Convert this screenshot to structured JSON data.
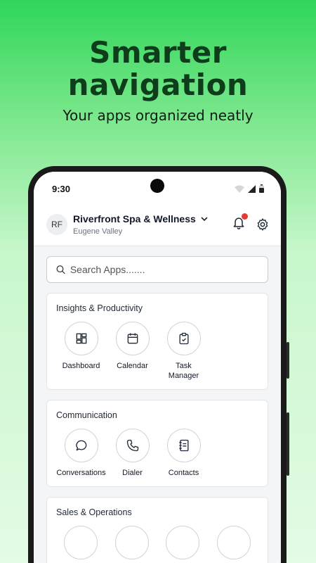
{
  "promo": {
    "title_line1": "Smarter",
    "title_line2": "navigation",
    "subtitle": "Your apps organized neatly"
  },
  "status_bar": {
    "time": "9:30"
  },
  "header": {
    "avatar_initials": "RF",
    "org_name": "Riverfront Spa & Wellness",
    "location": "Eugene Valley",
    "icons": [
      "chevron-down-icon",
      "bell-icon",
      "gear-icon"
    ],
    "notification_dot_color": "#e53935"
  },
  "search": {
    "placeholder": "Search Apps......."
  },
  "sections": [
    {
      "title": "Insights & Productivity",
      "apps": [
        {
          "label": "Dashboard",
          "icon": "dashboard-icon"
        },
        {
          "label": "Calendar",
          "icon": "calendar-icon"
        },
        {
          "label_line1": "Task",
          "label_line2": "Manager",
          "icon": "clipboard-check-icon"
        }
      ]
    },
    {
      "title": "Communication",
      "apps": [
        {
          "label": "Conversations",
          "icon": "chat-bubble-icon"
        },
        {
          "label": "Dialer",
          "icon": "phone-icon"
        },
        {
          "label": "Contacts",
          "icon": "contacts-book-icon"
        }
      ]
    },
    {
      "title": "Sales & Operations",
      "apps": []
    }
  ],
  "colors": {
    "brand_green": "#2fd65a",
    "title_dark_green": "#0d3d1a"
  }
}
